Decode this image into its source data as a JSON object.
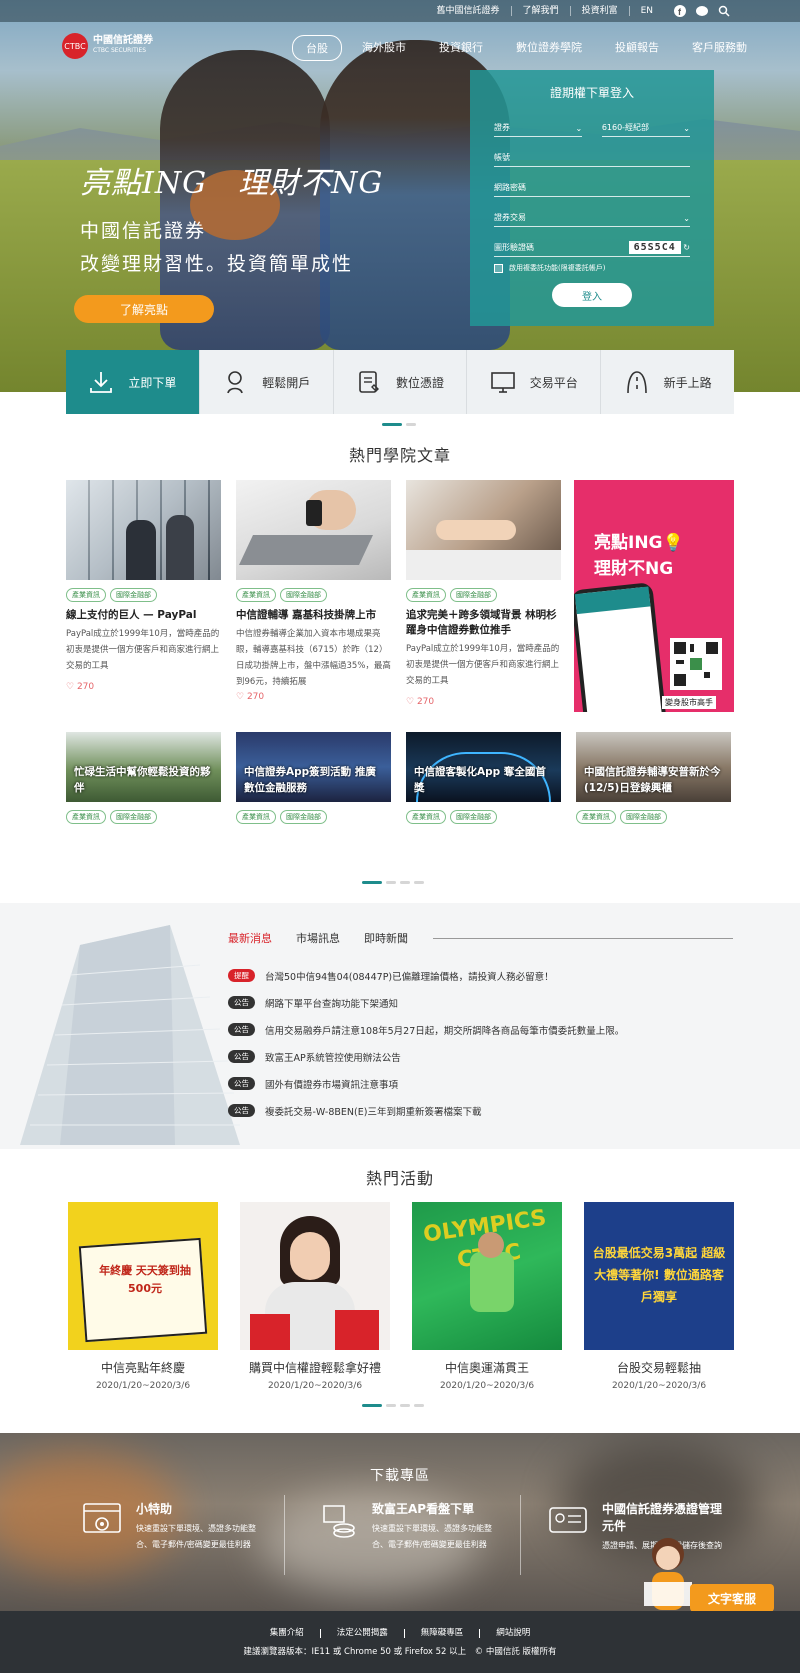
{
  "topbar": {
    "links": [
      "舊中國信託證券",
      "了解我們",
      "投資利富",
      "EN"
    ],
    "icons": [
      "facebook-icon",
      "line-icon",
      "search-icon"
    ]
  },
  "brand": {
    "name": "中國信託證券",
    "name_en": "CTBC SECURITIES",
    "mark": "CTBC"
  },
  "nav": {
    "items": [
      "台股",
      "海外股市",
      "投資銀行",
      "數位證券學院",
      "投顧報告",
      "客戶服務動"
    ],
    "active": "台股"
  },
  "hero": {
    "slogan1": "亮點ING　理財不NG",
    "slogan2": "中國信託證券",
    "slogan3": "改變理財習性。投資簡單成性",
    "button": "了解亮點"
  },
  "login": {
    "title": "證期權下單登入",
    "broker_label": "證券",
    "branch_value": "6160-經紀部",
    "account_label": "帳號",
    "password_label": "網路密碼",
    "trade_label": "證券交易",
    "captcha_label": "圖形驗證碼",
    "captcha_code": "65S5C4",
    "remember_label": "啟用複委託功能(限複委託帳戶)",
    "submit": "登入"
  },
  "quick": [
    {
      "label": "立即下單",
      "icon": "download-icon"
    },
    {
      "label": "輕鬆開戶",
      "icon": "user-icon"
    },
    {
      "label": "數位憑證",
      "icon": "certificate-icon"
    },
    {
      "label": "交易平台",
      "icon": "monitor-icon"
    },
    {
      "label": "新手上路",
      "icon": "road-icon"
    }
  ],
  "academy": {
    "title": "熱門學院文章",
    "tags": [
      "產業資訊",
      "國際金融部"
    ],
    "articles": [
      {
        "title": "線上支付的巨人 — PayPal",
        "desc": "PayPal成立於1999年10月，當時產品的初衷是提供一個方便客戶和商家進行網上交易的工具",
        "likes": "270"
      },
      {
        "title": "中信證輔導 嘉基科技掛牌上市",
        "desc": "中信證券輔導企業加入資本市場成果亮眼，輔導嘉基科技（6715）於昨（12）日成功掛牌上市，盤中漲幅過35%，最高到96元，持續拓展",
        "likes": "270"
      },
      {
        "title": "追求完美＋跨多領域背景 林明杉躍身中信證券數位推手",
        "desc": "PayPal成立於1999年10月，當時產品的初衷是提供一個方便客戶和商家進行網上交易的工具",
        "likes": "270"
      }
    ],
    "promo": {
      "title": "亮點ING\n理財不NG",
      "qr_caption": "變身股市高手"
    },
    "mini": [
      "忙碌生活中幫你輕鬆投資的夥伴",
      "中信證券App簽到活動 推廣數位金融服務",
      "中信證客製化App 奪全國首獎",
      "中國信託證券輔導安普新於今(12/5)日登錄興櫃"
    ]
  },
  "news": {
    "tabs": [
      "最新消息",
      "市場訊息",
      "即時新聞"
    ],
    "items": [
      {
        "badge": "提醒",
        "text": "台灣50中信94售04(08447P)已偏離理論價格，請投資人務必留意！"
      },
      {
        "badge": "公告",
        "text": "網路下單平台查詢功能下架通知"
      },
      {
        "badge": "公告",
        "text": "信用交易融券戶請注意108年5月27日起，期交所調降各商品每筆市價委託數量上限。"
      },
      {
        "badge": "公告",
        "text": "致富王AP系統管控使用辦法公告"
      },
      {
        "badge": "公告",
        "text": "國外有價證券市場資訊注意事項"
      },
      {
        "badge": "公告",
        "text": "複委託交易-W-8BEN(E)三年到期重新簽署檔案下載"
      }
    ]
  },
  "events": {
    "title": "熱門活動",
    "items": [
      {
        "name": "中信亮點年終慶",
        "date": "2020/1/20~2020/3/6",
        "art": "年終慶 天天簽到抽500元"
      },
      {
        "name": "購買中信權證輕鬆拿好禮",
        "date": "2020/1/20~2020/3/6",
        "art": ""
      },
      {
        "name": "中信奧運滿貫王",
        "date": "2020/1/20~2020/3/6",
        "art": "OLYMPICS CTBC"
      },
      {
        "name": "台股交易輕鬆抽",
        "date": "2020/1/20~2020/3/6",
        "art": "台股最低交易3萬起 超級大禮等著你! 數位通路客戶獨享"
      }
    ]
  },
  "download": {
    "title": "下載專區",
    "items": [
      {
        "title": "小特助",
        "desc": "快速重設下單環境、憑證多功能整合、電子郵件/密碼變更最佳利器",
        "icon": "settings-window-icon"
      },
      {
        "title": "致富王AP看盤下單",
        "desc": "快速重設下單環境、憑證多功能整合、電子郵件/密碼變更最佳利器",
        "icon": "coins-icon"
      },
      {
        "title": "中國信託證券憑證管理元件",
        "desc": "憑證申請、展期、下載儲存後查詢",
        "icon": "id-card-icon"
      }
    ],
    "chat": "文字客服"
  },
  "footer": {
    "links": [
      "集團介紹",
      "法定公開揭露",
      "無障礙專區",
      "網站說明"
    ],
    "copyright": "建議瀏覽器版本：IE11 或 Chrome 50 或 Firefox 52 以上　© 中國信託 版權所有"
  }
}
